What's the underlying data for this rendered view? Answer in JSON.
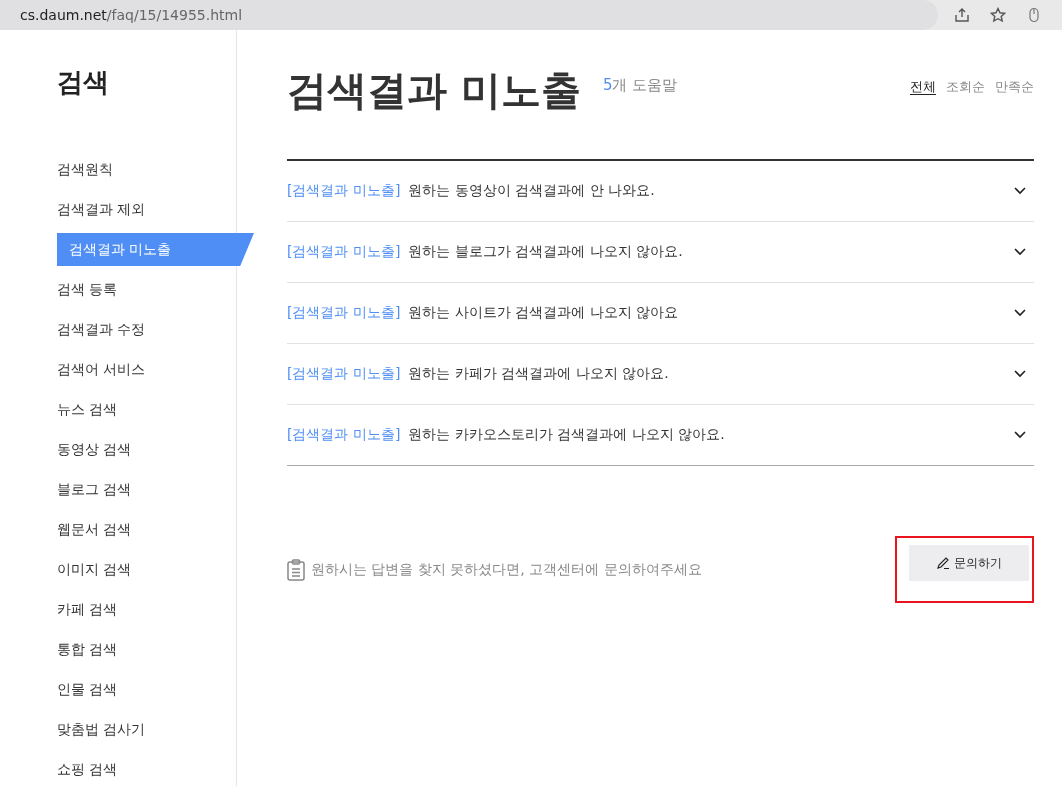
{
  "browser": {
    "url_host": "cs.daum.net",
    "url_path": "/faq/15/14955.html"
  },
  "sidebar": {
    "title": "검색",
    "items": [
      {
        "label": "검색원칙",
        "selected": false
      },
      {
        "label": "검색결과 제외",
        "selected": false
      },
      {
        "label": "검색결과 미노출",
        "selected": true
      },
      {
        "label": "검색 등록",
        "selected": false
      },
      {
        "label": "검색결과 수정",
        "selected": false
      },
      {
        "label": "검색어 서비스",
        "selected": false
      },
      {
        "label": "뉴스 검색",
        "selected": false
      },
      {
        "label": "동영상 검색",
        "selected": false
      },
      {
        "label": "블로그 검색",
        "selected": false
      },
      {
        "label": "웹문서 검색",
        "selected": false
      },
      {
        "label": "이미지 검색",
        "selected": false
      },
      {
        "label": "카페 검색",
        "selected": false
      },
      {
        "label": "통합 검색",
        "selected": false
      },
      {
        "label": "인물 검색",
        "selected": false
      },
      {
        "label": "맞춤법 검사기",
        "selected": false
      },
      {
        "label": "쇼핑 검색",
        "selected": false
      }
    ]
  },
  "header": {
    "title": "검색결과 미노출",
    "count": "5",
    "count_label": "개 도움말",
    "sort_options": [
      {
        "label": "전체",
        "selected": true
      },
      {
        "label": "조회순",
        "selected": false
      },
      {
        "label": "만족순",
        "selected": false
      }
    ]
  },
  "faq_items": [
    {
      "category": "[검색결과 미노출]",
      "question": "원하는 동영상이 검색결과에 안 나와요.",
      "expanded": false
    },
    {
      "category": "[검색결과 미노출]",
      "question": "원하는 블로그가 검색결과에 나오지 않아요.",
      "expanded": false
    },
    {
      "category": "[검색결과 미노출]",
      "question": "원하는 사이트가 검색결과에 나오지 않아요",
      "expanded": false
    },
    {
      "category": "[검색결과 미노출]",
      "question": "원하는 카페가 검색결과에 나오지 않아요.",
      "expanded": false
    },
    {
      "category": "[검색결과 미노출]",
      "question": "원하는 카카오스토리가 검색결과에 나오지 않아요.",
      "expanded": false
    }
  ],
  "inquiry": {
    "text": "원하시는 답변을 찾지 못하셨다면, 고객센터에 문의하여주세요",
    "button": "문의하기"
  }
}
